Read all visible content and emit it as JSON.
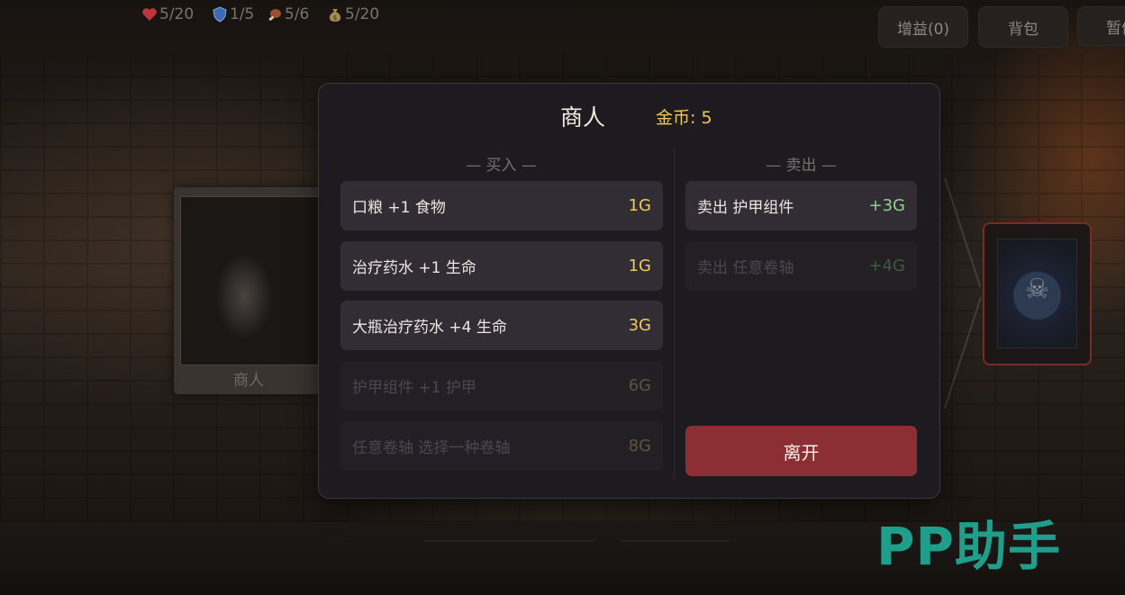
{
  "hud": {
    "health": "5/20",
    "armor": "1/5",
    "food": "5/6",
    "gold": "5/20",
    "icons": [
      "heart-icon",
      "shield-icon",
      "food-icon",
      "money-bag-icon"
    ],
    "colors": {
      "heart": "#c0353b",
      "shield": "#3c6ab2"
    }
  },
  "top_buttons": {
    "buffs": "增益(0)",
    "backpack": "背包",
    "pause": "暂停"
  },
  "left_card": {
    "caption": "商人"
  },
  "shop": {
    "title": "商人",
    "gold_label": "金币: 5",
    "buy_header": "— 买入 —",
    "sell_header": "— 卖出 —",
    "buy_items": [
      {
        "label": "口粮 +1 食物",
        "price": "1G",
        "enabled": true
      },
      {
        "label": "治疗药水 +1 生命",
        "price": "1G",
        "enabled": true
      },
      {
        "label": "大瓶治疗药水 +4 生命",
        "price": "3G",
        "enabled": true
      },
      {
        "label": "护甲组件 +1 护甲",
        "price": "6G",
        "enabled": false
      },
      {
        "label": "任意卷轴 选择一种卷轴",
        "price": "8G",
        "enabled": false
      }
    ],
    "sell_items": [
      {
        "label": "卖出 护甲组件",
        "price": "+3G",
        "enabled": true
      },
      {
        "label": "卖出 任意卷轴",
        "price": "+4G",
        "enabled": false
      }
    ],
    "leave_label": "离开",
    "colors": {
      "price": "#f0c95c",
      "sell_price": "#8fd08a",
      "leave": "#8c2f34"
    }
  },
  "watermark": "PP助手"
}
